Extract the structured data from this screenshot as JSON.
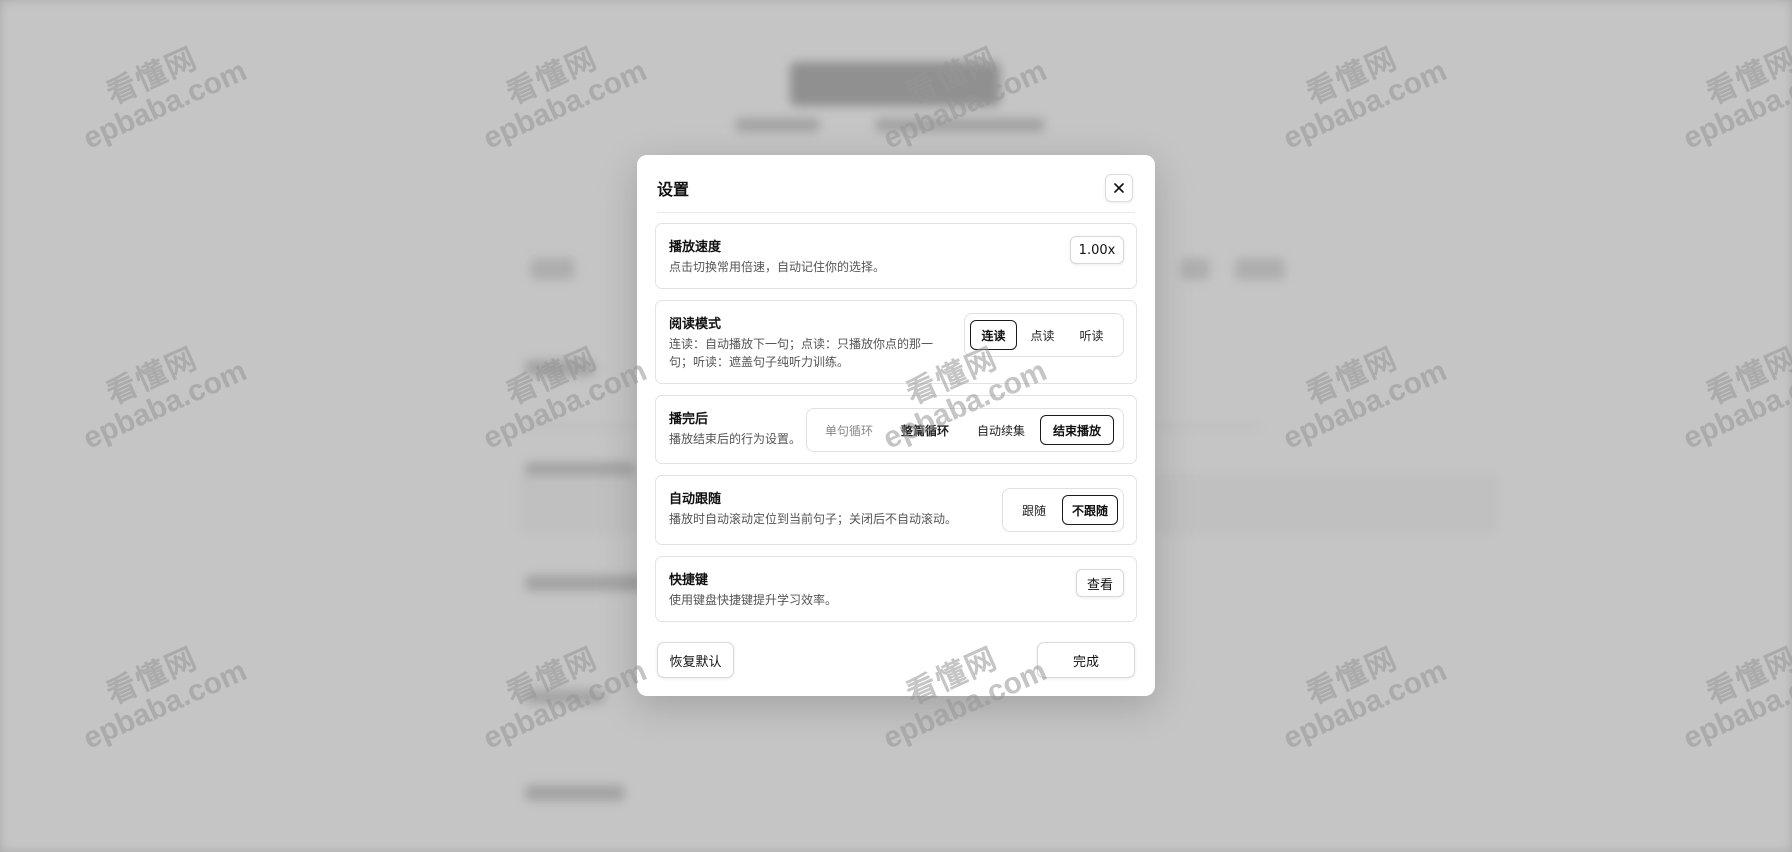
{
  "dialog": {
    "title": "设置",
    "sections": {
      "speed": {
        "title": "播放速度",
        "desc": "点击切换常用倍速，自动记住你的选择。",
        "value": "1.00x"
      },
      "mode": {
        "title": "阅读模式",
        "desc": "连读：自动播放下一句；点读：只播放你点的那一句；听读：遮盖句子纯听力训练。",
        "options": [
          "连读",
          "点读",
          "听读"
        ],
        "selected": "连读"
      },
      "after": {
        "title": "播完后",
        "desc": "播放结束后的行为设置。",
        "options": [
          "单句循环",
          "整篇循环",
          "自动续集",
          "结束播放"
        ],
        "selected": "结束播放"
      },
      "follow": {
        "title": "自动跟随",
        "desc": "播放时自动滚动定位到当前句子；关闭后不自动滚动。",
        "options": [
          "跟随",
          "不跟随"
        ],
        "selected": "不跟随"
      },
      "shortcuts": {
        "title": "快捷键",
        "desc": "使用键盘快捷键提升学习效率。",
        "button": "查看"
      }
    },
    "footer": {
      "reset_label": "恢复默认",
      "done_label": "完成"
    },
    "close_icon": "close-icon"
  },
  "watermark": {
    "cn": "看懂网",
    "en": "epbaba.com"
  }
}
